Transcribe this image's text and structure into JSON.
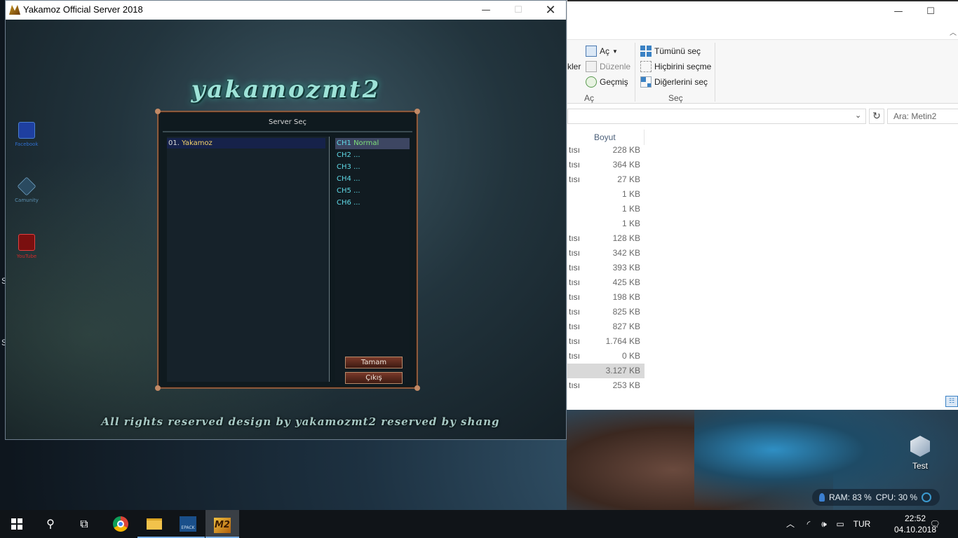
{
  "game_window": {
    "title": "Yakamoz Official Server 2018",
    "controls": {
      "minimize": "—",
      "maximize": "☐",
      "close": "✕"
    },
    "logo": "yakamozmt2",
    "side_links": [
      {
        "label": "Facebook",
        "color": "#2f6fd0"
      },
      {
        "label": "Camunity",
        "color": "#5a8fb0"
      },
      {
        "label": "YouTube",
        "color": "#d02a2a"
      }
    ],
    "footer": "All rights reserved    design by yakamozmt2    reserved by shang"
  },
  "server_dialog": {
    "title": "Server Seç",
    "servers": [
      {
        "number": "01.",
        "name": "Yakamoz"
      }
    ],
    "channels": [
      {
        "name": "CH1",
        "status": "Normal"
      },
      {
        "name": "CH2",
        "status": "..."
      },
      {
        "name": "CH3",
        "status": "..."
      },
      {
        "name": "CH4",
        "status": "..."
      },
      {
        "name": "CH5",
        "status": "..."
      },
      {
        "name": "CH6",
        "status": "..."
      }
    ],
    "ok_label": "Tamam",
    "exit_label": "Çıkış"
  },
  "explorer": {
    "controls": {
      "minimize": "—",
      "maximize": "☐"
    },
    "ribbon": {
      "open_group": {
        "label": "Aç",
        "partial_label": "kler",
        "items": {
          "open": "Aç",
          "edit": "Düzenle",
          "history": "Geçmiş"
        }
      },
      "select_group": {
        "label": "Seç",
        "items": {
          "select_all": "Tümünü seç",
          "select_none": "Hiçbirini seçme",
          "invert": "Diğerlerini seç"
        }
      }
    },
    "search_placeholder": "Ara: Metin2",
    "column_size": "Boyut",
    "files": [
      {
        "type": "tısı",
        "size": "228 KB"
      },
      {
        "type": "tısı",
        "size": "364 KB"
      },
      {
        "type": "tısı",
        "size": "27 KB"
      },
      {
        "type": "",
        "size": "1 KB"
      },
      {
        "type": "",
        "size": "1 KB"
      },
      {
        "type": "",
        "size": "1 KB"
      },
      {
        "type": "tısı",
        "size": "128 KB"
      },
      {
        "type": "tısı",
        "size": "342 KB"
      },
      {
        "type": "tısı",
        "size": "393 KB"
      },
      {
        "type": "tısı",
        "size": "425 KB"
      },
      {
        "type": "tısı",
        "size": "198 KB"
      },
      {
        "type": "tısı",
        "size": "825 KB"
      },
      {
        "type": "tısı",
        "size": "827 KB"
      },
      {
        "type": "tısı",
        "size": "1.764 KB"
      },
      {
        "type": "tısı",
        "size": "0 KB"
      },
      {
        "type": "",
        "size": "3.127 KB",
        "selected": true
      },
      {
        "type": "tısı",
        "size": "253 KB"
      }
    ]
  },
  "desktop": {
    "left_edge_chars": [
      "S",
      "S"
    ],
    "icon_label": "Test"
  },
  "resource_widget": {
    "ram": "RAM: 83 %",
    "cpu": "CPU: 30 %"
  },
  "taskbar": {
    "language": "TUR",
    "time": "22:52",
    "date": "04.10.2018",
    "epack_label": "EPACK",
    "m2_label": "M2"
  }
}
